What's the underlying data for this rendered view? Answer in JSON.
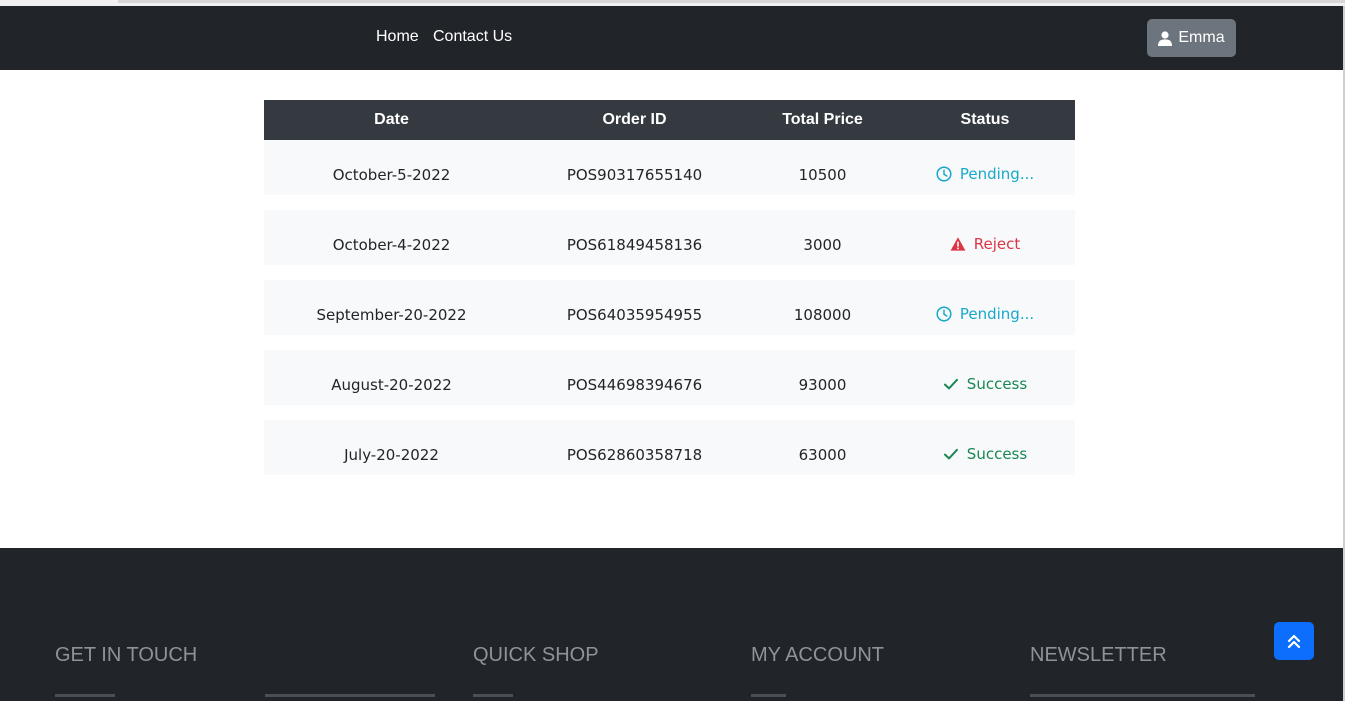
{
  "navbar": {
    "links": [
      "Home",
      "Contact Us"
    ],
    "user_button": {
      "label": "Emma",
      "icon": "user-icon"
    }
  },
  "orders_table": {
    "headers": [
      "Date",
      "Order ID",
      "Total Price",
      "Status"
    ],
    "rows": [
      {
        "date": "October-5-2022",
        "order_id": "POS90317655140",
        "total_price": "10500",
        "status": "Pending...",
        "status_type": "pending"
      },
      {
        "date": "October-4-2022",
        "order_id": "POS61849458136",
        "total_price": "3000",
        "status": "Reject",
        "status_type": "reject"
      },
      {
        "date": "September-20-2022",
        "order_id": "POS64035954955",
        "total_price": "108000",
        "status": "Pending...",
        "status_type": "pending"
      },
      {
        "date": "August-20-2022",
        "order_id": "POS44698394676",
        "total_price": "93000",
        "status": "Success",
        "status_type": "success"
      },
      {
        "date": "July-20-2022",
        "order_id": "POS62860358718",
        "total_price": "63000",
        "status": "Success",
        "status_type": "success"
      }
    ]
  },
  "status_styles": {
    "pending": {
      "icon": "clock-icon",
      "color": "#17a9c9"
    },
    "reject": {
      "icon": "warning-icon",
      "color": "#dc3545"
    },
    "success": {
      "icon": "check-icon",
      "color": "#198754"
    }
  },
  "footer": {
    "headings": [
      "GET IN TOUCH",
      "QUICK SHOP",
      "MY ACCOUNT",
      "NEWSLETTER"
    ]
  },
  "back_to_top": {
    "icon": "double-chevron-up-icon",
    "color": "#0d6efd"
  },
  "colors": {
    "navbar_bg": "#212529",
    "table_header_bg": "#343a40",
    "row_bg": "#f8f9fa",
    "footer_heading": "#8e9398"
  }
}
